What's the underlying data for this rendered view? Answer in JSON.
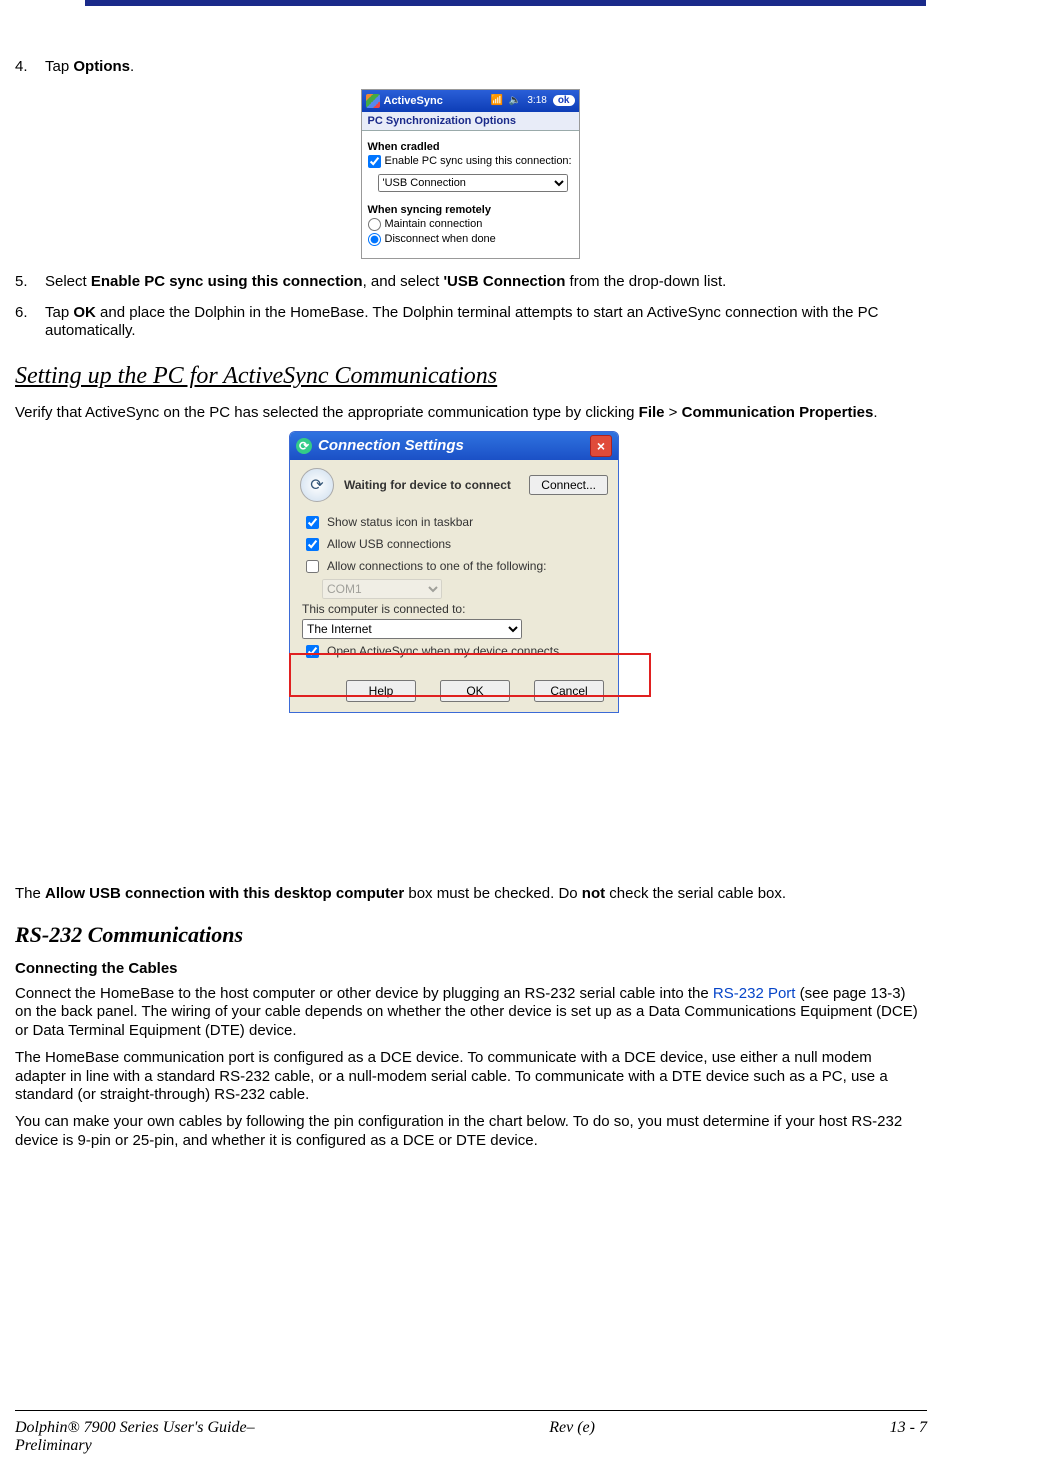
{
  "steps": {
    "s4": {
      "num": "4.",
      "text_a": "Tap ",
      "bold": "Options",
      "text_b": "."
    },
    "s5": {
      "num": "5.",
      "text_a": "Select ",
      "bold1": "Enable PC sync using this connection",
      "text_b": ", and select ",
      "bold2": "'USB Connection",
      "text_c": " from the drop-down list."
    },
    "s6": {
      "num": "6.",
      "text_a": "Tap ",
      "bold": "OK",
      "text_b": " and place the Dolphin in the HomeBase. The Dolphin terminal attempts to start an ActiveSync connection with the PC automatically."
    }
  },
  "mobile": {
    "app": "ActiveSync",
    "time": "3:18",
    "ok": "ok",
    "subtitle": "PC Synchronization Options",
    "cradled_title": "When cradled",
    "enable_label": "Enable PC sync using this connection:",
    "select_value": "'USB Connection",
    "remote_title": "When syncing remotely",
    "maintain": "Maintain connection",
    "disconnect": "Disconnect when done"
  },
  "heading1": "Setting up the PC for ActiveSync Communications",
  "verify": {
    "a": "Verify that ActiveSync on the PC has selected the appropriate communication type by clicking ",
    "b": "File",
    "c": " > ",
    "d": "Communication Properties",
    "e": "."
  },
  "dlg": {
    "title": "Connection Settings",
    "waiting": "Waiting for device to connect",
    "connect": "Connect...",
    "show_status": "Show status icon in taskbar",
    "allow_usb": "Allow USB connections",
    "allow_com": "Allow connections to one of the following:",
    "com_value": "COM1",
    "connected_to": "This computer is connected to:",
    "internet": "The Internet",
    "open_sync": "Open ActiveSync when my device connects",
    "help": "Help",
    "ok": "OK",
    "cancel": "Cancel"
  },
  "allow_line": {
    "a": "The ",
    "b": "Allow USB connection with this desktop computer",
    "c": " box must be checked. Do ",
    "d": "not",
    "e": " check the serial cable box."
  },
  "heading2": "RS-232 Communications",
  "sub_cables": "Connecting the Cables",
  "p1": {
    "a": "Connect the HomeBase to the host computer or other device by plugging an RS-232 serial cable into the ",
    "link": "RS-232 Port",
    "b": " (see page 13-3) on the back panel. The wiring of your cable depends on whether the other device is set up as a Data Communications Equipment (DCE) or Data Terminal Equipment (DTE) device."
  },
  "p2": "The HomeBase communication port is configured as a DCE device. To communicate with a DCE device, use either a null modem adapter in line with a standard RS-232 cable, or a null-modem serial cable. To communicate with a DTE device such as a PC, use a standard (or straight-through) RS-232 cable.",
  "p3": "You can make your own cables by following the pin configuration in the chart below. To do so, you must determine if your host RS-232 device is 9-pin or 25-pin, and whether it is configured as a DCE or DTE device.",
  "footer": {
    "left1": "Dolphin® 7900 Series User's Guide–",
    "left2": "Preliminary",
    "center": "Rev (e)",
    "right": "13 - 7"
  }
}
